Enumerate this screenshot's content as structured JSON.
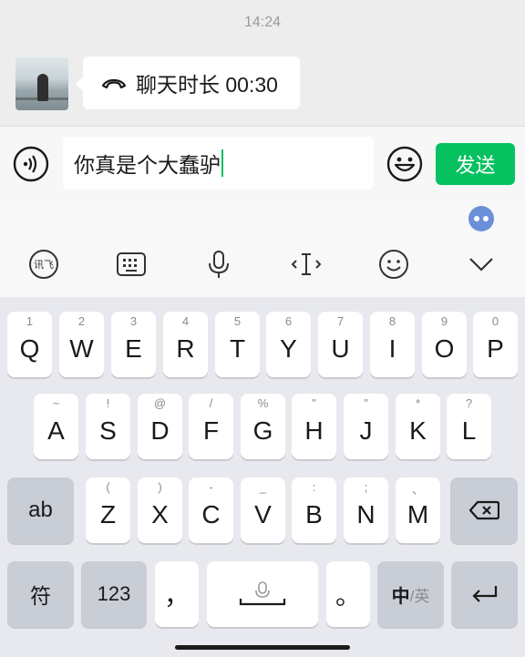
{
  "chat": {
    "timestamp": "14:24",
    "call_bubble_text": "聊天时长 00:30"
  },
  "input": {
    "value": "你真是个大蠢驴",
    "send_label": "发送"
  },
  "toolbar": {
    "icons": [
      "xunfei-icon",
      "keyboard-icon",
      "mic-icon",
      "cursor-icon",
      "emoji-icon",
      "collapse-icon"
    ],
    "xunfei_text": "讯飞"
  },
  "keyboard": {
    "row1": [
      {
        "main": "Q",
        "sub": "1"
      },
      {
        "main": "W",
        "sub": "2"
      },
      {
        "main": "E",
        "sub": "3"
      },
      {
        "main": "R",
        "sub": "4"
      },
      {
        "main": "T",
        "sub": "5"
      },
      {
        "main": "Y",
        "sub": "6"
      },
      {
        "main": "U",
        "sub": "7"
      },
      {
        "main": "I",
        "sub": "8"
      },
      {
        "main": "O",
        "sub": "9"
      },
      {
        "main": "P",
        "sub": "0"
      }
    ],
    "row2": [
      {
        "main": "A",
        "sub": "~"
      },
      {
        "main": "S",
        "sub": "!"
      },
      {
        "main": "D",
        "sub": "@"
      },
      {
        "main": "F",
        "sub": "/"
      },
      {
        "main": "G",
        "sub": "%"
      },
      {
        "main": "H",
        "sub": "\""
      },
      {
        "main": "J",
        "sub": "\""
      },
      {
        "main": "K",
        "sub": "*"
      },
      {
        "main": "L",
        "sub": "?"
      }
    ],
    "row3": [
      {
        "main": "Z",
        "sub": "("
      },
      {
        "main": "X",
        "sub": ")"
      },
      {
        "main": "C",
        "sub": "-"
      },
      {
        "main": "V",
        "sub": "_"
      },
      {
        "main": "B",
        "sub": ":"
      },
      {
        "main": "N",
        "sub": ";"
      },
      {
        "main": "M",
        "sub": "、"
      }
    ],
    "ab_label": "ab",
    "symbol_label": "符",
    "num_label": "123",
    "comma_label": "，",
    "period_label": "。",
    "lang_main": "中",
    "lang_alt": "/英"
  },
  "colors": {
    "accent": "#07c160",
    "keyboard_bg": "#e8e9ee",
    "dark_key": "#c9cdd6"
  }
}
